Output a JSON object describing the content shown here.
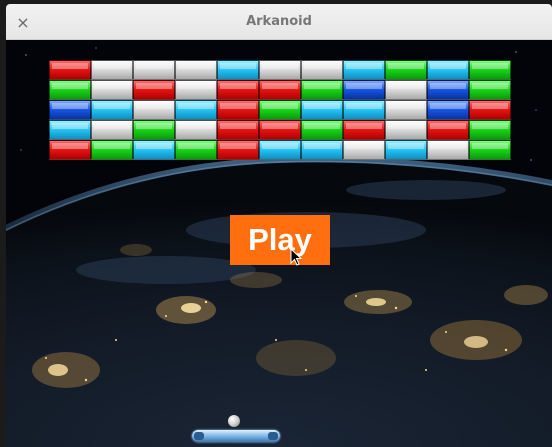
{
  "window": {
    "title": "Arkanoid",
    "close_icon": "×"
  },
  "menu": {
    "play_label": "Play"
  },
  "bricks": {
    "rows": [
      [
        "red",
        "white",
        "white",
        "white",
        "cyan",
        "white",
        "white",
        "cyan",
        "green",
        "cyan",
        "green"
      ],
      [
        "green",
        "white",
        "red",
        "white",
        "red",
        "red",
        "green",
        "blue",
        "white",
        "blue",
        "green"
      ],
      [
        "blue",
        "cyan",
        "white",
        "cyan",
        "red",
        "green",
        "cyan",
        "cyan",
        "white",
        "blue",
        "red"
      ],
      [
        "cyan",
        "white",
        "green",
        "white",
        "red",
        "red",
        "green",
        "red",
        "white",
        "red",
        "green"
      ],
      [
        "red",
        "green",
        "cyan",
        "green",
        "red",
        "cyan",
        "cyan",
        "white",
        "cyan",
        "white",
        "green"
      ]
    ]
  },
  "icons": {
    "ball": "ball-icon",
    "paddle": "paddle-icon",
    "cursor": "mouse-cursor-icon"
  }
}
